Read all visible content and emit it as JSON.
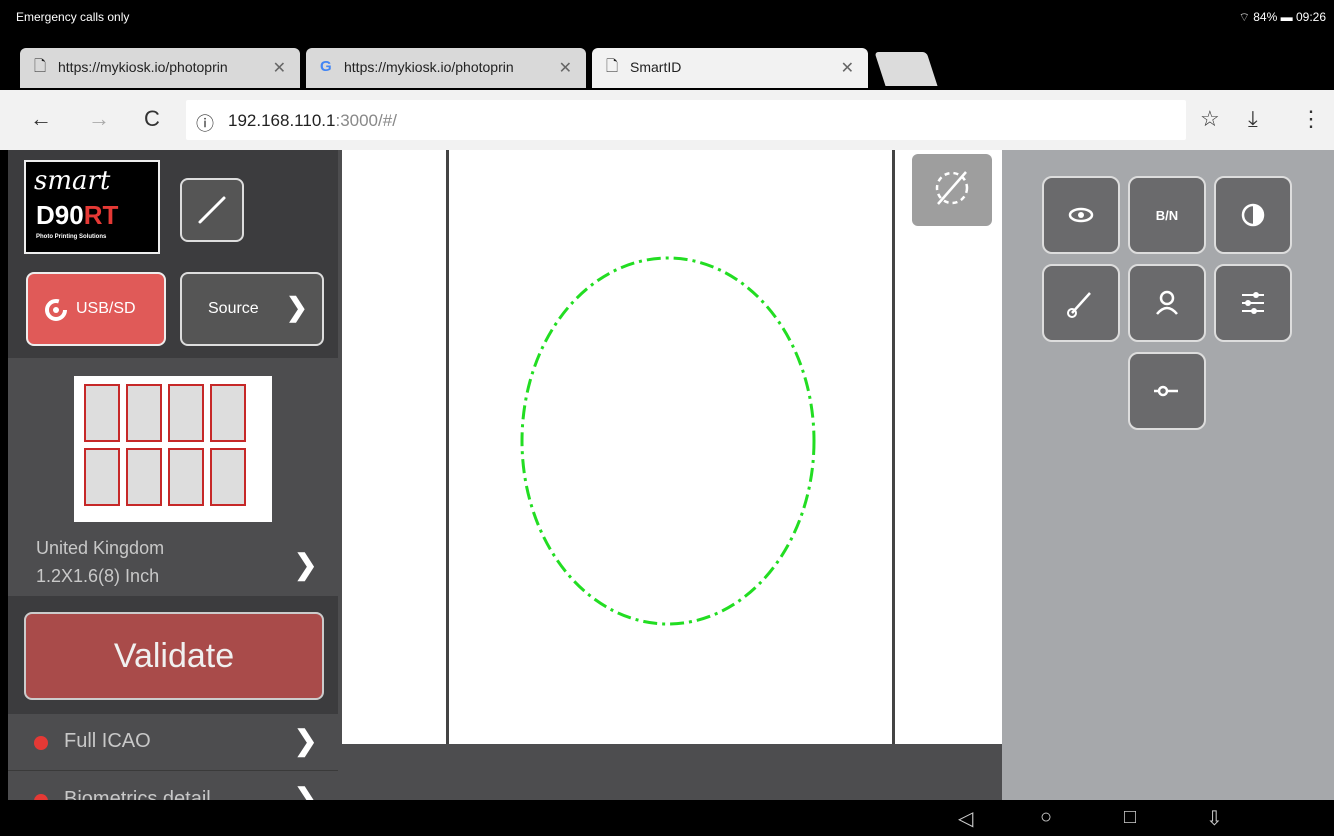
{
  "status_bar": {
    "left_text": "Emergency calls only",
    "battery": "84%",
    "time": "09:26"
  },
  "tabs": [
    {
      "title": "https://mykiosk.io/photoprin",
      "icon": "page-icon",
      "active": false
    },
    {
      "title": "https://mykiosk.io/photoprin",
      "icon": "google-icon",
      "active": false
    },
    {
      "title": "SmartID",
      "icon": "page-icon",
      "active": true
    }
  ],
  "address_bar": {
    "host": "192.168.110.1",
    "rest": ":3000/#/"
  },
  "sidebar": {
    "logo": {
      "line1": "smart",
      "line2a": "D90",
      "line2b": "RT",
      "tagline": "Photo Printing Solutions"
    },
    "usb_label": "USB/SD",
    "source_label": "Source",
    "format": {
      "country": "United Kingdom",
      "size": "1.2X1.6(8) Inch"
    },
    "validate_label": "Validate",
    "checks": [
      {
        "label": "Full ICAO"
      },
      {
        "label": "Biometrics detail"
      }
    ]
  },
  "tools": {
    "bw_label": "B/N"
  },
  "colors": {
    "accent_red": "#e05a58",
    "validate_red": "#a94b4a",
    "guide_green": "#22dd22",
    "panel_dark": "#4d4d4f",
    "panel_light": "#a6a8ab"
  }
}
